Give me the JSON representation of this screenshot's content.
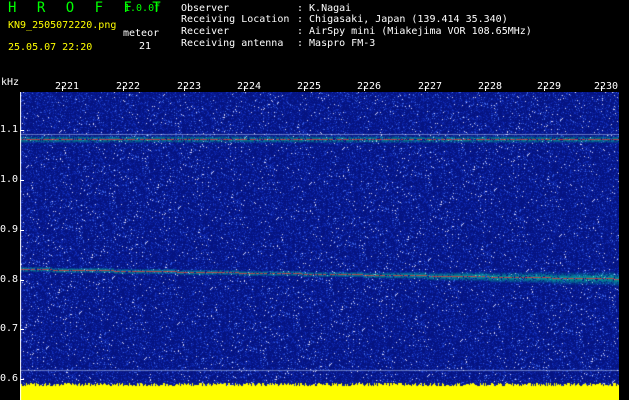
{
  "header": {
    "title": "H R O F F T",
    "version": "1.0.0f",
    "filename": "KN9_2505072220.png",
    "meteor_label": "meteor",
    "date": "25.05.07 22:20",
    "meteor_count": "21"
  },
  "metadata": [
    {
      "key": "Observer",
      "value": ": K.Nagai"
    },
    {
      "key": "Receiving Location",
      "value": ": Chigasaki, Japan (139.414 35.340)"
    },
    {
      "key": "Receiver",
      "value": ": AirSpy mini (Miakejima VOR 108.65MHz)"
    },
    {
      "key": "Receiving antenna",
      "value": ": Maspro FM-3"
    }
  ],
  "y_axis": {
    "unit": "kHz",
    "ticks": [
      "1.1",
      "1.0",
      "0.9",
      "0.8",
      "0.7",
      "0.6"
    ]
  },
  "x_axis": {
    "ticks": [
      "2221",
      "2222",
      "2223",
      "2224",
      "2225",
      "2226",
      "2227",
      "2228",
      "2229",
      "2230"
    ]
  },
  "colors": {
    "background": "#000000",
    "noise": "#0a1a8c",
    "signal": "#00ff80",
    "baseline": "#ffff00",
    "header_green": "#00ff00",
    "header_yellow": "#ffff00"
  }
}
